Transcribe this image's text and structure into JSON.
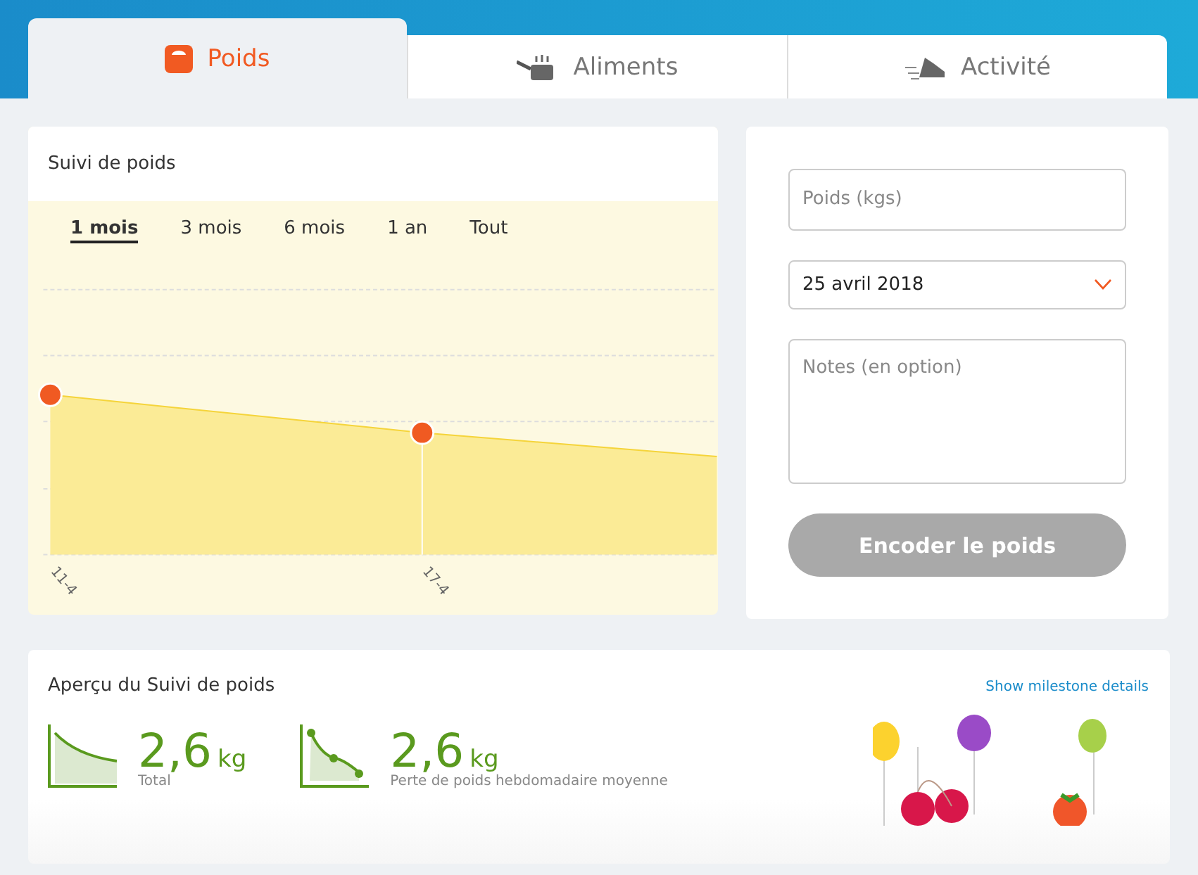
{
  "tabs": [
    {
      "label": "Poids",
      "kind": "scale",
      "selected": true
    },
    {
      "label": "Aliments",
      "kind": "pan",
      "selected": false
    },
    {
      "label": "Activité",
      "kind": "shoe",
      "selected": false
    }
  ],
  "chart_card": {
    "title": "Suivi de poids",
    "ranges": [
      {
        "label": "1 mois",
        "selected": true
      },
      {
        "label": "3 mois",
        "selected": false
      },
      {
        "label": "6 mois",
        "selected": false
      },
      {
        "label": "1 an",
        "selected": false
      },
      {
        "label": "Tout",
        "selected": false
      }
    ],
    "x_labels": [
      "11-4",
      "17-4"
    ]
  },
  "form": {
    "weight": {
      "placeholder": "Poids (kgs)"
    },
    "date": {
      "value": "25 avril 2018"
    },
    "notes": {
      "placeholder": "Notes (en option)"
    },
    "submit": {
      "label": "Encoder le poids",
      "disabled": true
    }
  },
  "overview": {
    "title": "Aperçu du Suivi de poids",
    "link": "Show milestone details",
    "stats": [
      {
        "kind": "total",
        "value": "2,6",
        "unit": "kg",
        "label": "Total"
      },
      {
        "kind": "weekly",
        "value": "2,6",
        "unit": "kg",
        "label": "Perte de poids hebdomadaire moyenne"
      }
    ]
  }
}
